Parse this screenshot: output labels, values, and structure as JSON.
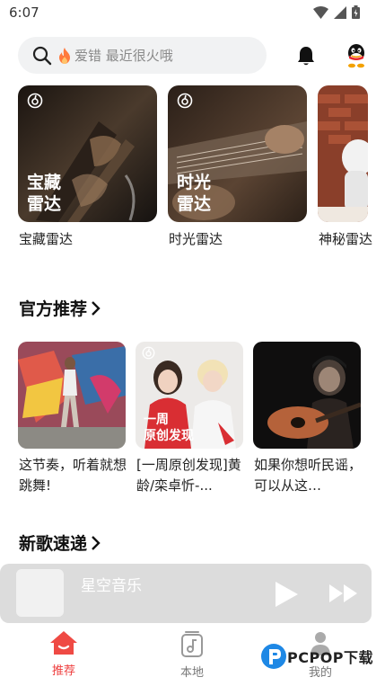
{
  "status": {
    "time": "6:07"
  },
  "search": {
    "hint_keyword": "爱错",
    "hint_text": "最近很火哦"
  },
  "radar": [
    {
      "overlay": [
        "宝藏",
        "雷达"
      ],
      "label": "宝藏雷达"
    },
    {
      "overlay": [
        "时光",
        "雷达"
      ],
      "label": "时光雷达"
    },
    {
      "overlay": [],
      "label": "神秘雷达"
    }
  ],
  "official": {
    "title": "官方推荐",
    "items": [
      {
        "text": "这节奏，听着就想跳舞!",
        "overlay": ""
      },
      {
        "text": "[一周原创发现]黄龄/栾卓忻-...",
        "overlay_line1": "一周",
        "overlay_line2": "原创发现"
      },
      {
        "text": "如果你想听民谣，可以从这…",
        "overlay": ""
      }
    ]
  },
  "new_songs": {
    "title": "新歌速递"
  },
  "player": {
    "title": "星空音乐"
  },
  "nav": {
    "items": [
      {
        "label": "推荐",
        "active": true
      },
      {
        "label": "本地",
        "active": false
      },
      {
        "label": "我的",
        "active": false
      }
    ]
  },
  "watermark": {
    "text": "PCPOP下载"
  },
  "colors": {
    "accent": "#ee3d3d",
    "search_bg": "#f1f2f3",
    "player_bg": "#dcdcdc"
  }
}
